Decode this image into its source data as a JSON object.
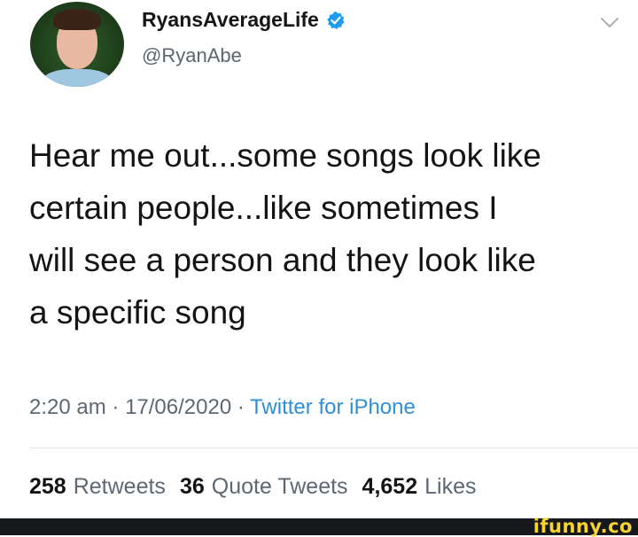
{
  "tweet": {
    "display_name": "RyansAverageLife",
    "handle": "@RyanAbe",
    "verified": true,
    "text_lines": [
      "Hear me out...some songs look like",
      "certain people...like sometimes I",
      "will see a person and they look like",
      "a specific song"
    ],
    "time": "2:20 am",
    "date": "17/06/2020",
    "source": "Twitter for iPhone",
    "separator": "·",
    "stats": {
      "retweets_count": "258",
      "retweets_label": "Retweets",
      "quotes_count": "36",
      "quotes_label": "Quote Tweets",
      "likes_count": "4,652",
      "likes_label": "Likes"
    }
  },
  "watermark": {
    "text": "ifunny.co"
  },
  "colors": {
    "verified": "#1d9bf0",
    "link": "#2e8fd8",
    "muted": "#5e6872",
    "footer_bg": "#16181c",
    "watermark": "#f7d52b"
  },
  "icons": {
    "verified": "verified-badge-icon",
    "menu": "chevron-down-icon"
  }
}
